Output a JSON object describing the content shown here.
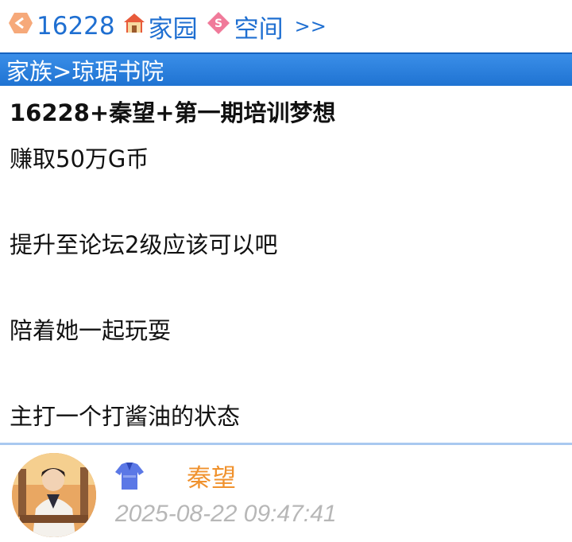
{
  "nav": {
    "user_id": "16228",
    "home_label": "家园",
    "space_label": "空间",
    "more_label": ">>",
    "icons": {
      "user": "hexagon-arrow-icon",
      "home": "house-icon",
      "space": "diamond-s-icon"
    }
  },
  "breadcrumb": {
    "text": "家族>琼琚书院"
  },
  "post": {
    "title": "16228+秦望+第一期培训梦想",
    "paragraphs": [
      "赚取50万G币",
      "提升至论坛2级应该可以吧",
      "陪着她一起玩耍",
      "主打一个打酱油的状态"
    ]
  },
  "author": {
    "name": "秦望",
    "timestamp": "2025-08-22 09:47:41",
    "badge_icon": "robe-icon"
  },
  "colors": {
    "link": "#1f6fd1",
    "header_bar": "#2a80de",
    "author_name": "#f0922e",
    "timestamp": "#b7b7b7",
    "divider": "#a9c9f0"
  }
}
